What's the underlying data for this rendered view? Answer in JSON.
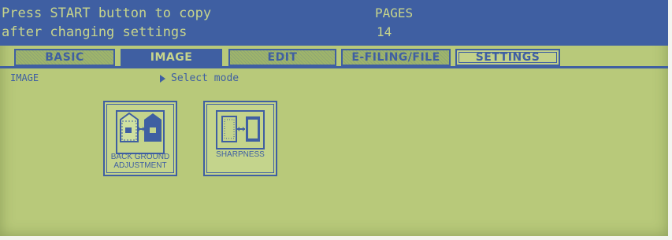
{
  "header": {
    "message_line1": "Press START button to copy",
    "message_line2": "after changing settings",
    "pages_label": "PAGES",
    "pages_value": "14"
  },
  "tabs": [
    {
      "label": "BASIC",
      "active": false
    },
    {
      "label": "IMAGE",
      "active": true
    },
    {
      "label": "EDIT",
      "active": false
    },
    {
      "label": "E-FILING/FILE",
      "active": false
    },
    {
      "label": "SETTINGS",
      "active": false
    }
  ],
  "breadcrumb": "IMAGE",
  "prompt": "Select mode",
  "modes": [
    {
      "label_line1": "BACK GROUND",
      "label_line2": "ADJUSTMENT",
      "icon": "background-adjustment-icon"
    },
    {
      "label_line1": "SHARPNESS",
      "label_line2": "",
      "icon": "sharpness-icon"
    }
  ],
  "colors": {
    "lcd_background": "#b8c97a",
    "accent": "#3f5fa2",
    "header_text": "#c8d58b"
  }
}
